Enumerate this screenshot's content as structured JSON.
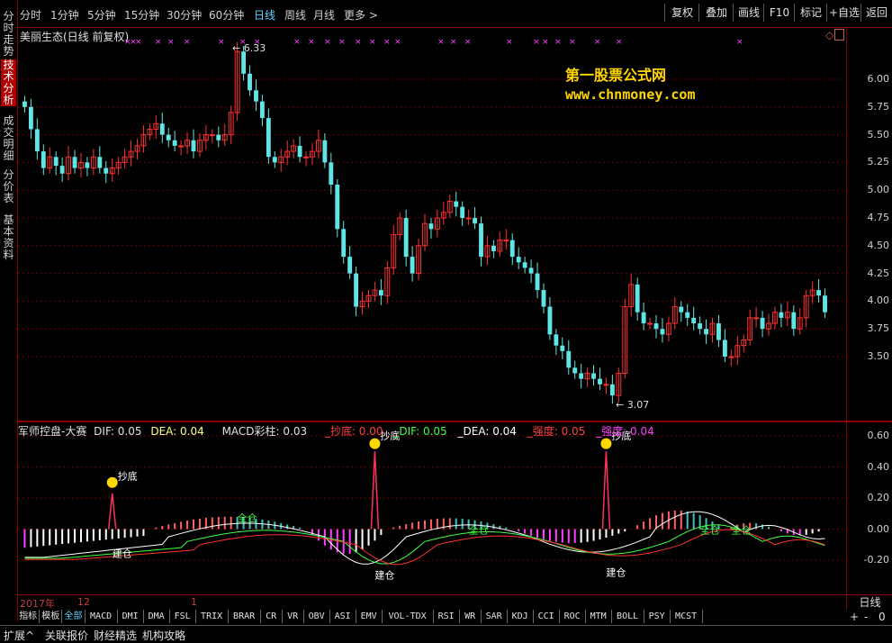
{
  "toolbar": {
    "timeframes": [
      "分时",
      "1分钟",
      "5分钟",
      "15分钟",
      "30分钟",
      "60分钟",
      "日线",
      "周线",
      "月线",
      "更多 >"
    ],
    "active_index": 6,
    "buttons": [
      "复权",
      "叠加",
      "画线",
      "F10",
      "标记",
      "+自选",
      "返回"
    ]
  },
  "left_tabs": [
    "分时走势",
    "技术分析",
    "成交明细",
    "分价表",
    "基本资料"
  ],
  "left_active": 1,
  "stock": {
    "name": "美丽生态(日线 前复权)",
    "high_label": "6.33",
    "low_label": "3.07"
  },
  "watermark": {
    "line1": "第一股票公式网",
    "line2": "www.chnmoney.com"
  },
  "price_scale": [
    "6.00",
    "5.75",
    "5.50",
    "5.25",
    "5.00",
    "4.75",
    "4.50",
    "4.25",
    "4.00",
    "3.75",
    "3.50"
  ],
  "indicator": {
    "name": "军师控盘-大赛",
    "dif": "DIF: 0.05",
    "dea": "DEA: 0.04",
    "macd": "MACD彩柱: 0.03",
    "chaodi": "_抄底: 0.00",
    "dif2": "_DIF: 0.05",
    "dea2": "_DEA: 0.04",
    "qiangdu1": "_强度: 0.05",
    "qiangdu2": "_强度: 0.04",
    "labels": {
      "chaodi": "抄底",
      "jiancang": "建仓",
      "quancang": "全仓"
    },
    "scale": [
      "0.60",
      "0.40",
      "0.20",
      "0.00",
      "-0.20"
    ]
  },
  "dates": {
    "year": "2017年",
    "m1": "12",
    "m2": "1"
  },
  "period_label": "日线",
  "zoom": [
    "+",
    "-",
    "0"
  ],
  "indicator_tabs": [
    "指标",
    "模板",
    "全部",
    "MACD",
    "DMI",
    "DMA",
    "FSL",
    "TRIX",
    "BRAR",
    "CR",
    "VR",
    "OBV",
    "ASI",
    "EMV",
    "VOL-TDX",
    "RSI",
    "WR",
    "SAR",
    "KDJ",
    "CCI",
    "ROC",
    "MTM",
    "BOLL",
    "PSY",
    "MCST"
  ],
  "indicator_tab_active": 2,
  "bottom_tabs": [
    "扩展^",
    "关联报价",
    "财经精选",
    "机构攻略"
  ],
  "colors": {
    "up": "#ff3030",
    "down": "#5fe5e5",
    "grid": "#8b0000",
    "accent": "#5fd3ff"
  }
}
